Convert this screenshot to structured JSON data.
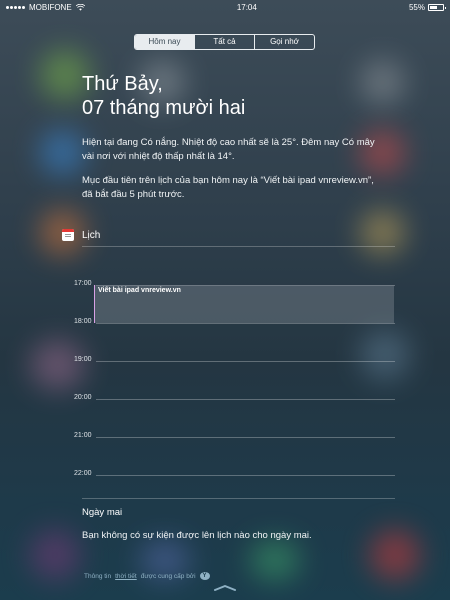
{
  "status": {
    "carrier": "MOBIFONE",
    "time": "17:04",
    "battery": "55%",
    "battery_level": 0.55
  },
  "tabs": [
    {
      "label": "Hôm nay",
      "active": true
    },
    {
      "label": "Tất cả",
      "active": false
    },
    {
      "label": "Gọi nhớ",
      "active": false
    }
  ],
  "today": {
    "day": "Thứ Bảy,",
    "date": "07 tháng mười hai",
    "weather": "Hiện tại đang Có nắng. Nhiệt độ cao nhất sẽ là 25°. Đêm nay Có mây vài nơi với nhiệt độ thấp nhất là 14°.",
    "calendar_summary": "Mục đầu tiên trên lịch của bạn hôm nay là “Viết bài ipad vnreview.vn”, đã bắt đầu 5 phút trước."
  },
  "calendar": {
    "title": "Lịch",
    "hours": [
      "17:00",
      "18:00",
      "19:00",
      "20:00",
      "21:00",
      "22:00"
    ],
    "event": {
      "title": "Viết bài ipad vnreview.vn"
    }
  },
  "tomorrow": {
    "title": "Ngày mai",
    "text": "Bạn không có sự kiện được lên lịch nào cho ngày mai."
  },
  "footer": {
    "prefix": "Thông tin",
    "link": "thời tiết",
    "suffix": "được cung cấp bởi",
    "provider_icon": "Y"
  },
  "icons": [
    "wifi-icon",
    "calendar-icon",
    "yahoo-icon",
    "grabber-chevron-icon"
  ]
}
